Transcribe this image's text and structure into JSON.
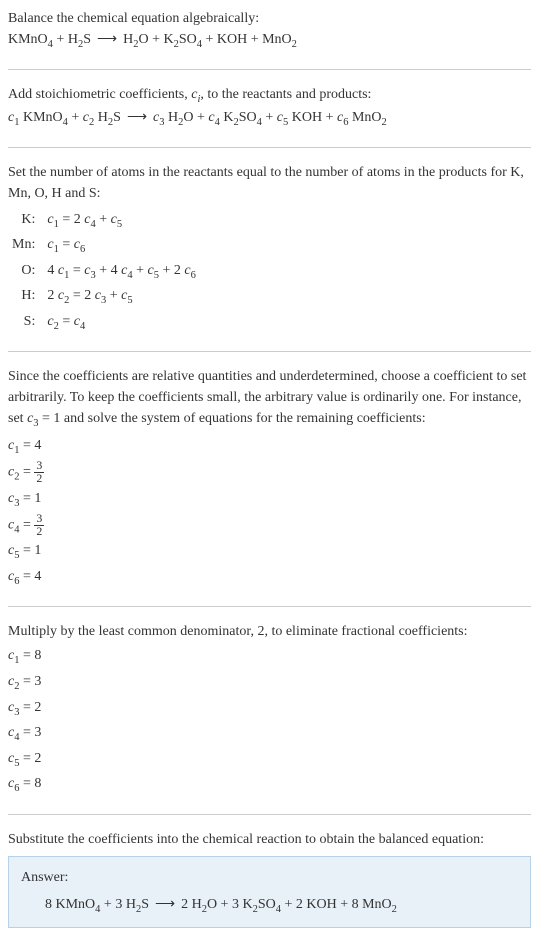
{
  "section1": {
    "intro": "Balance the chemical equation algebraically:",
    "eq_lhs1": "KMnO",
    "eq_lhs1_sub": "4",
    "plus": " + ",
    "eq_lhs2": "H",
    "eq_lhs2_sub": "2",
    "eq_lhs3": "S",
    "arrow": "⟶",
    "eq_rhs1": "H",
    "eq_rhs1_sub": "2",
    "eq_rhs2": "O + K",
    "eq_rhs2_sub": "2",
    "eq_rhs3": "SO",
    "eq_rhs3_sub": "4",
    "eq_rhs4": " + KOH + MnO",
    "eq_rhs4_sub": "2"
  },
  "section2": {
    "intro": "Add stoichiometric coefficients, ",
    "ci": "c",
    "ci_sub": "i",
    "intro2": ", to the reactants and products:",
    "c1": "c",
    "c1_sub": "1",
    "sp1": " KMnO",
    "sp1_sub": "4",
    "plus": " + ",
    "c2": "c",
    "c2_sub": "2",
    "sp2": " H",
    "sp2_sub": "2",
    "sp2b": "S",
    "arrow": "⟶",
    "c3": "c",
    "c3_sub": "3",
    "sp3": " H",
    "sp3_sub": "2",
    "sp3b": "O + ",
    "c4": "c",
    "c4_sub": "4",
    "sp4": " K",
    "sp4_sub": "2",
    "sp4b": "SO",
    "sp4b_sub": "4",
    "sp4c": " + ",
    "c5": "c",
    "c5_sub": "5",
    "sp5": " KOH + ",
    "c6": "c",
    "c6_sub": "6",
    "sp6": " MnO",
    "sp6_sub": "2"
  },
  "section3": {
    "intro": "Set the number of atoms in the reactants equal to the number of atoms in the products for K, Mn, O, H and S:",
    "rows": [
      {
        "label": "K:",
        "lhs_c": "c",
        "lhs_sub": "1",
        "eq": " = 2 ",
        "r1_c": "c",
        "r1_sub": "4",
        "mid": " + ",
        "r2_c": "c",
        "r2_sub": "5",
        "rest": ""
      },
      {
        "label": "Mn:",
        "lhs_c": "c",
        "lhs_sub": "1",
        "eq": " = ",
        "r1_c": "c",
        "r1_sub": "6",
        "mid": "",
        "r2_c": "",
        "r2_sub": "",
        "rest": ""
      },
      {
        "label": "O:",
        "lhs_pre": "4 ",
        "lhs_c": "c",
        "lhs_sub": "1",
        "eq": " = ",
        "r1_c": "c",
        "r1_sub": "3",
        "mid": " + 4 ",
        "r2_c": "c",
        "r2_sub": "4",
        "mid2": " + ",
        "r3_c": "c",
        "r3_sub": "5",
        "mid3": " + 2 ",
        "r4_c": "c",
        "r4_sub": "6"
      },
      {
        "label": "H:",
        "lhs_pre": "2 ",
        "lhs_c": "c",
        "lhs_sub": "2",
        "eq": " = 2 ",
        "r1_c": "c",
        "r1_sub": "3",
        "mid": " + ",
        "r2_c": "c",
        "r2_sub": "5",
        "rest": ""
      },
      {
        "label": "S:",
        "lhs_c": "c",
        "lhs_sub": "2",
        "eq": " = ",
        "r1_c": "c",
        "r1_sub": "4",
        "mid": "",
        "r2_c": "",
        "r2_sub": "",
        "rest": ""
      }
    ]
  },
  "section4": {
    "intro": "Since the coefficients are relative quantities and underdetermined, choose a coefficient to set arbitrarily. To keep the coefficients small, the arbitrary value is ordinarily one. For instance, set ",
    "c3": "c",
    "c3_sub": "3",
    "intro2": " = 1 and solve the system of equations for the remaining coefficients:",
    "c1_label": "c",
    "c1_sub": "1",
    "c1_val": " = 4",
    "c2_label": "c",
    "c2_sub": "2",
    "c2_eq": " = ",
    "c2_num": "3",
    "c2_den": "2",
    "c3_label": "c",
    "c3_sub2": "3",
    "c3_val": " = 1",
    "c4_label": "c",
    "c4_sub": "4",
    "c4_eq": " = ",
    "c4_num": "3",
    "c4_den": "2",
    "c5_label": "c",
    "c5_sub": "5",
    "c5_val": " = 1",
    "c6_label": "c",
    "c6_sub": "6",
    "c6_val": " = 4"
  },
  "section5": {
    "intro": "Multiply by the least common denominator, 2, to eliminate fractional coefficients:",
    "c1_label": "c",
    "c1_sub": "1",
    "c1_val": " = 8",
    "c2_label": "c",
    "c2_sub": "2",
    "c2_val": " = 3",
    "c3_label": "c",
    "c3_sub": "3",
    "c3_val": " = 2",
    "c4_label": "c",
    "c4_sub": "4",
    "c4_val": " = 3",
    "c5_label": "c",
    "c5_sub": "5",
    "c5_val": " = 2",
    "c6_label": "c",
    "c6_sub": "6",
    "c6_val": " = 8"
  },
  "section6": {
    "intro": "Substitute the coefficients into the chemical reaction to obtain the balanced equation:",
    "answer_label": "Answer:",
    "eq_pre": "8 KMnO",
    "eq_sub1": "4",
    "eq_mid1": " + 3 H",
    "eq_sub2": "2",
    "eq_mid2": "S",
    "arrow": "⟶",
    "eq_rhs1": "2 H",
    "eq_rsub1": "2",
    "eq_rhs2": "O + 3 K",
    "eq_rsub2": "2",
    "eq_rhs3": "SO",
    "eq_rsub3": "4",
    "eq_rhs4": " + 2 KOH + 8 MnO",
    "eq_rsub4": "2"
  }
}
